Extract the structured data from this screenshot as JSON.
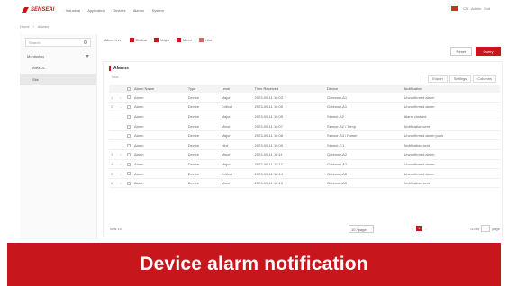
{
  "header": {
    "brand": "SENSEAI",
    "nav": [
      "· Industrial",
      "· Application",
      "· Devices",
      "· Alarms",
      "· System"
    ],
    "right": [
      "CN",
      "Admin",
      "Exit"
    ]
  },
  "breadcrumb": [
    "Home",
    "/",
    "Alarms"
  ],
  "sidebar": {
    "search_placeholder": "Search",
    "items": [
      {
        "label": "Monitoring"
      },
      {
        "label": "Area 01"
      },
      {
        "label": "Site"
      }
    ]
  },
  "legend": {
    "label": "Alarm level",
    "items": [
      {
        "label": "Critical",
        "color": "#c8161d"
      },
      {
        "label": "Major",
        "color": "#c8161d"
      },
      {
        "label": "Minor",
        "color": "#c8161d"
      },
      {
        "label": "Hint",
        "color": "#e06060"
      }
    ]
  },
  "actions": {
    "secondary": "Reset",
    "primary": "Query"
  },
  "panel": {
    "title": "Alarms",
    "subtitle": "Total",
    "toolbar": [
      "Export",
      "Settings",
      "Columns"
    ]
  },
  "table": {
    "headers": [
      "",
      "",
      "",
      "Alarm Name",
      "Type",
      "Level",
      "Time Received",
      "Device",
      "Notification"
    ],
    "rows": [
      {
        "idx": "1",
        "exp": "›",
        "name": "Alarm",
        "type": "Device",
        "level": "Major",
        "time": "2023-09-11 10:03",
        "device": "Gateway-A1",
        "note": "Unconfirmed alarm"
      },
      {
        "idx": "2",
        "exp": "⌄",
        "name": "Alarm",
        "type": "Device",
        "level": "Critical",
        "time": "2023-09-11 10:05",
        "device": "Gateway-A1",
        "note": "Unconfirmed alarm"
      },
      {
        "idx": "",
        "exp": "",
        "name": "Alarm",
        "type": "Device",
        "level": "Major",
        "time": "2023-09-11 10:05",
        "device": "Sensor-B2",
        "note": "Alarm cleared"
      },
      {
        "idx": "",
        "exp": "",
        "name": "Alarm",
        "type": "Device",
        "level": "Minor",
        "time": "2023-09-11 10:07",
        "device": "Sensor-B2 / Temp",
        "note": "Notification sent"
      },
      {
        "idx": "",
        "exp": "",
        "name": "Alarm",
        "type": "Device",
        "level": "Major",
        "time": "2023-09-11 10:08",
        "device": "Sensor-B3 / Power",
        "note": "Unconfirmed alarm push"
      },
      {
        "idx": "",
        "exp": "",
        "name": "Alarm",
        "type": "Device",
        "level": "Hint",
        "time": "2023-09-11 10:09",
        "device": "Sensor-C1",
        "note": "Notification sent"
      },
      {
        "idx": "3",
        "exp": "›",
        "name": "Alarm",
        "type": "Device",
        "level": "Minor",
        "time": "2023-09-11 10:11",
        "device": "Gateway-A2",
        "note": "Unconfirmed alarm"
      },
      {
        "idx": "4",
        "exp": "›",
        "name": "Alarm",
        "type": "Device",
        "level": "Major",
        "time": "2023-09-11 10:12",
        "device": "Gateway-A2",
        "note": "Unconfirmed alarm"
      },
      {
        "idx": "5",
        "exp": "›",
        "name": "Alarm",
        "type": "Device",
        "level": "Critical",
        "time": "2023-09-11 10:14",
        "device": "Gateway-A3",
        "note": "Unconfirmed alarm"
      },
      {
        "idx": "6",
        "exp": "›",
        "name": "Alarm",
        "type": "Device",
        "level": "Minor",
        "time": "2023-09-11 10:15",
        "device": "Gateway-A3",
        "note": "Notification sent"
      }
    ]
  },
  "pagination": {
    "total": "Total 10",
    "page_size": "10 / page",
    "prev": "‹",
    "current": "1",
    "next": "›",
    "goto": "Go to",
    "page_word": "page"
  },
  "caption": "Device alarm notification"
}
